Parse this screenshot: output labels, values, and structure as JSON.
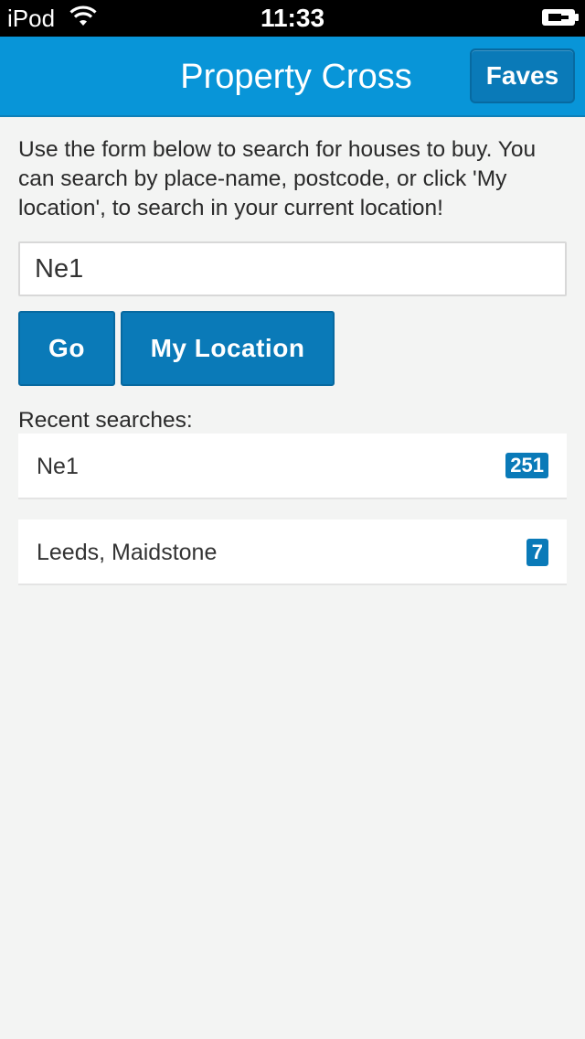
{
  "status_bar": {
    "carrier": "iPod",
    "time": "11:33",
    "wifi_icon": "wifi-icon",
    "battery_icon": "battery-charging-icon"
  },
  "header": {
    "title": "Property Cross",
    "faves_label": "Faves",
    "background_color": "#0895d8"
  },
  "intro": "Use the form below to search for houses to buy. You can search by place-name, postcode, or click 'My location', to search in your current location!",
  "search": {
    "value": "Ne1",
    "placeholder": ""
  },
  "buttons": {
    "go_label": "Go",
    "location_label": "My Location",
    "color": "#0a7ab8"
  },
  "recent": {
    "heading": "Recent searches:",
    "items": [
      {
        "label": "Ne1",
        "count": "251"
      },
      {
        "label": "Leeds, Maidstone",
        "count": "7"
      }
    ]
  }
}
